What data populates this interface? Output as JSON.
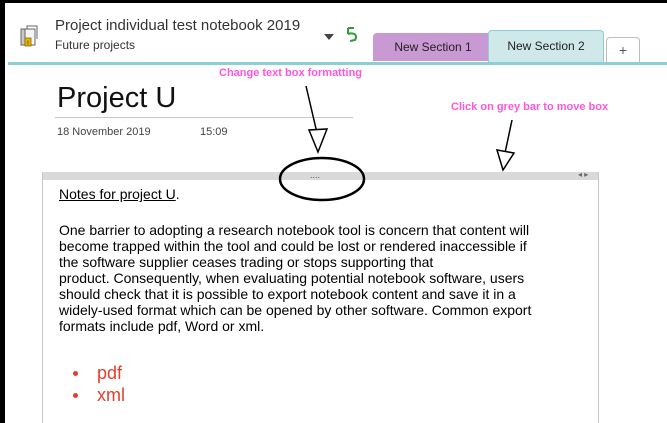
{
  "notebook": {
    "title": "Project individual test notebook 2019",
    "subtitle": "Future projects",
    "icon": "notebook-icon",
    "back_icon": "back-arrow-icon"
  },
  "tabs": [
    {
      "label": "New Section 1",
      "color": "#c999d4",
      "active": false
    },
    {
      "label": "New Section 2",
      "color": "#cfe9eb",
      "active": true
    },
    {
      "label": "+",
      "active": false
    }
  ],
  "page": {
    "title": "Project U",
    "date": "18 November 2019",
    "time": "15:09"
  },
  "annotations": {
    "format_hint": "Change text box formatting",
    "move_hint": "Click on grey bar to move box",
    "color": "#ff55dd"
  },
  "note": {
    "grab_handle": "....",
    "resize_glyph": "◂ ▸",
    "heading": "Notes for project U",
    "heading_suffix": ".",
    "lines": [
      "One barrier to adopting a research notebook tool is concern that content will",
      "become trapped within the tool and could be lost or rendered inaccessible if",
      "the software supplier ceases trading or stops supporting that",
      "product.  Consequently, when evaluating potential notebook software, users",
      "should check that it is possible to export notebook content and save it in a",
      "widely-used format which can be opened by other software. Common export",
      "formats include pdf, Word or xml."
    ],
    "bullets": [
      "pdf",
      "xml"
    ],
    "bullet_color": "#e0402c"
  }
}
